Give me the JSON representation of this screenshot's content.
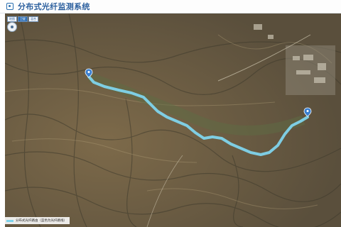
{
  "app": {
    "title": "分布式光纤监测系统",
    "logo_icon": "system-logo-icon"
  },
  "map": {
    "type_buttons": [
      {
        "label": "地图",
        "active": false
      },
      {
        "label": "卫星",
        "active": true
      },
      {
        "label": "混合",
        "active": false
      }
    ],
    "legend_text": "分布式光纤路由（蓝色为光纤路线）",
    "route_color": "#7fd4ec",
    "marker_color": "#3a7fd0",
    "imagery": "satellite"
  }
}
